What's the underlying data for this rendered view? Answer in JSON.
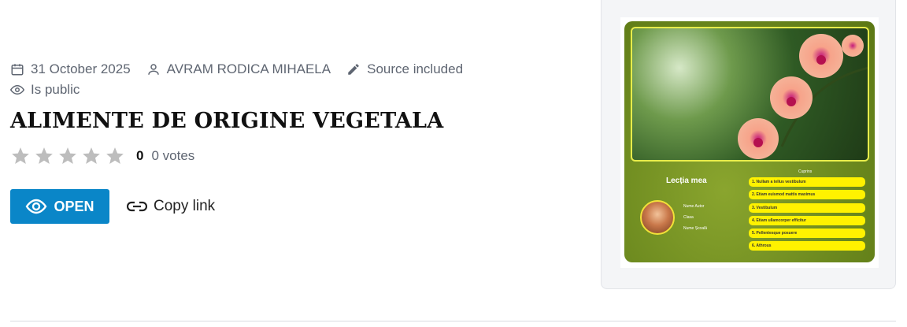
{
  "meta": {
    "date": "31 October 2025",
    "author": "AVRAM RODICA MIHAELA",
    "source": "Source included",
    "visibility": "Is public"
  },
  "title": "ALIMENTE DE ORIGINE VEGETALA",
  "rating": {
    "value": "0",
    "votes": "0 votes",
    "stars_total": 5,
    "stars_filled": 0
  },
  "actions": {
    "open_label": "OPEN",
    "copy_label": "Copy link"
  },
  "thumbnail": {
    "slide_title": "Lecția mea",
    "author_lines": [
      "Nume Autor",
      "Clasa",
      "Nume Școală"
    ],
    "toc_heading": "Cuprins",
    "toc_items": [
      "1. Nullam a tellus vestibulum",
      "2. Etiam euismod mattis maximus",
      "3. Vestibulum",
      "4. Etiam ullamcorper efficitur",
      "5. Pellentesque posuere",
      "6. Athrous"
    ]
  },
  "colors": {
    "accent": "#0a86c8",
    "muted_text": "#5f6672",
    "star": "#bdbdbd",
    "slide_green": "#6d8a1f",
    "toc_yellow": "#fff200"
  }
}
